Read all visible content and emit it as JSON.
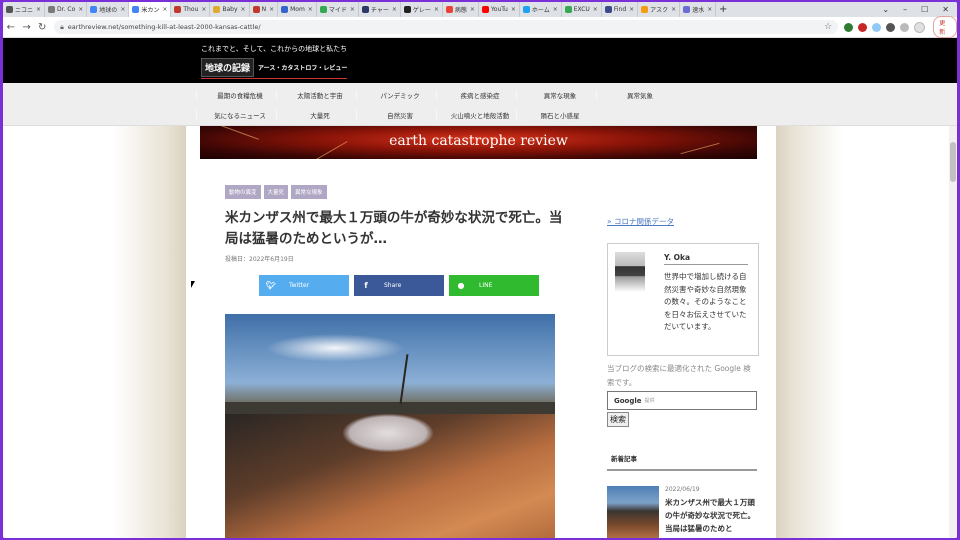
{
  "browser": {
    "tabs": [
      {
        "label": "ニコニ",
        "color": "#555555",
        "active": false
      },
      {
        "label": "Dr. Co",
        "color": "#7a7a7a",
        "active": false
      },
      {
        "label": "地球の",
        "color": "#4285f4",
        "active": false
      },
      {
        "label": "米カン",
        "color": "#4285f4",
        "active": true
      },
      {
        "label": "Thou",
        "color": "#c0392b",
        "active": false
      },
      {
        "label": "Baby",
        "color": "#e0aa30",
        "active": false
      },
      {
        "label": "N",
        "color": "#c0392b",
        "active": false
      },
      {
        "label": "Mom",
        "color": "#3366cc",
        "active": false
      },
      {
        "label": "マイド",
        "color": "#34a853",
        "active": false
      },
      {
        "label": "チャー",
        "color": "#2b3a67",
        "active": false
      },
      {
        "label": "ゲレー",
        "color": "#222222",
        "active": false
      },
      {
        "label": "病態",
        "color": "#ea4335",
        "active": false
      },
      {
        "label": "YouTu",
        "color": "#ff0000",
        "active": false
      },
      {
        "label": "ホーム",
        "color": "#1da1f2",
        "active": false
      },
      {
        "label": "EXCU",
        "color": "#34a853",
        "active": false
      },
      {
        "label": "Find",
        "color": "#3c4a8c",
        "active": false
      },
      {
        "label": "アスク",
        "color": "#f39c12",
        "active": false
      },
      {
        "label": "速水",
        "color": "#6b6bd6",
        "active": false
      }
    ],
    "new_tab": "+",
    "url": "earthreview.net/something-kill-at-least-2000-kansas-cattle/",
    "update_label": "更新"
  },
  "site": {
    "tagline": "これまでと、そして、これからの地球と私たち",
    "logo_main": "地球の記録",
    "logo_sub": "アース・カタストロフ・レビュー",
    "banner_text": "earth catastrophe review"
  },
  "nav": {
    "row1": [
      "最期の食糧危機",
      "太陽活動と宇宙",
      "パンデミック",
      "疾病と感染症",
      "異常な現象",
      "異常気象"
    ],
    "row2": [
      "気になるニュース",
      "大量死",
      "自然災害",
      "火山噴火と地殻活動",
      "隕石と小惑星"
    ]
  },
  "article": {
    "tags": [
      "動物の異変",
      "大量死",
      "異常な現象"
    ],
    "title": "米カンザス州で最大１万頭の牛が奇妙な状況で死亡。当局は猛暑のためというが…",
    "date": "投稿日：2022年6月19日",
    "share": {
      "twitter": "Twitter",
      "facebook": "Share",
      "line": "LINE"
    }
  },
  "sidebar": {
    "covid_link": "» コロナ関係データ",
    "profile_name": "Y. Oka",
    "profile_bio": "世界中で増加し続ける自然災害や奇妙な自然現象の数々。そのようなことを日々お伝えさせていただいています。",
    "search_desc": "当ブログの検索に最適化された Google 検索です。",
    "search_brand": "Google",
    "search_placeholder": "提供",
    "search_button": "検索",
    "recent_header": "新着記事",
    "recent_date": "2022/06/19",
    "recent_title": "米カンザス州で最大１万頭の牛が奇妙な状況で死亡。当局は猛暑のためと"
  }
}
